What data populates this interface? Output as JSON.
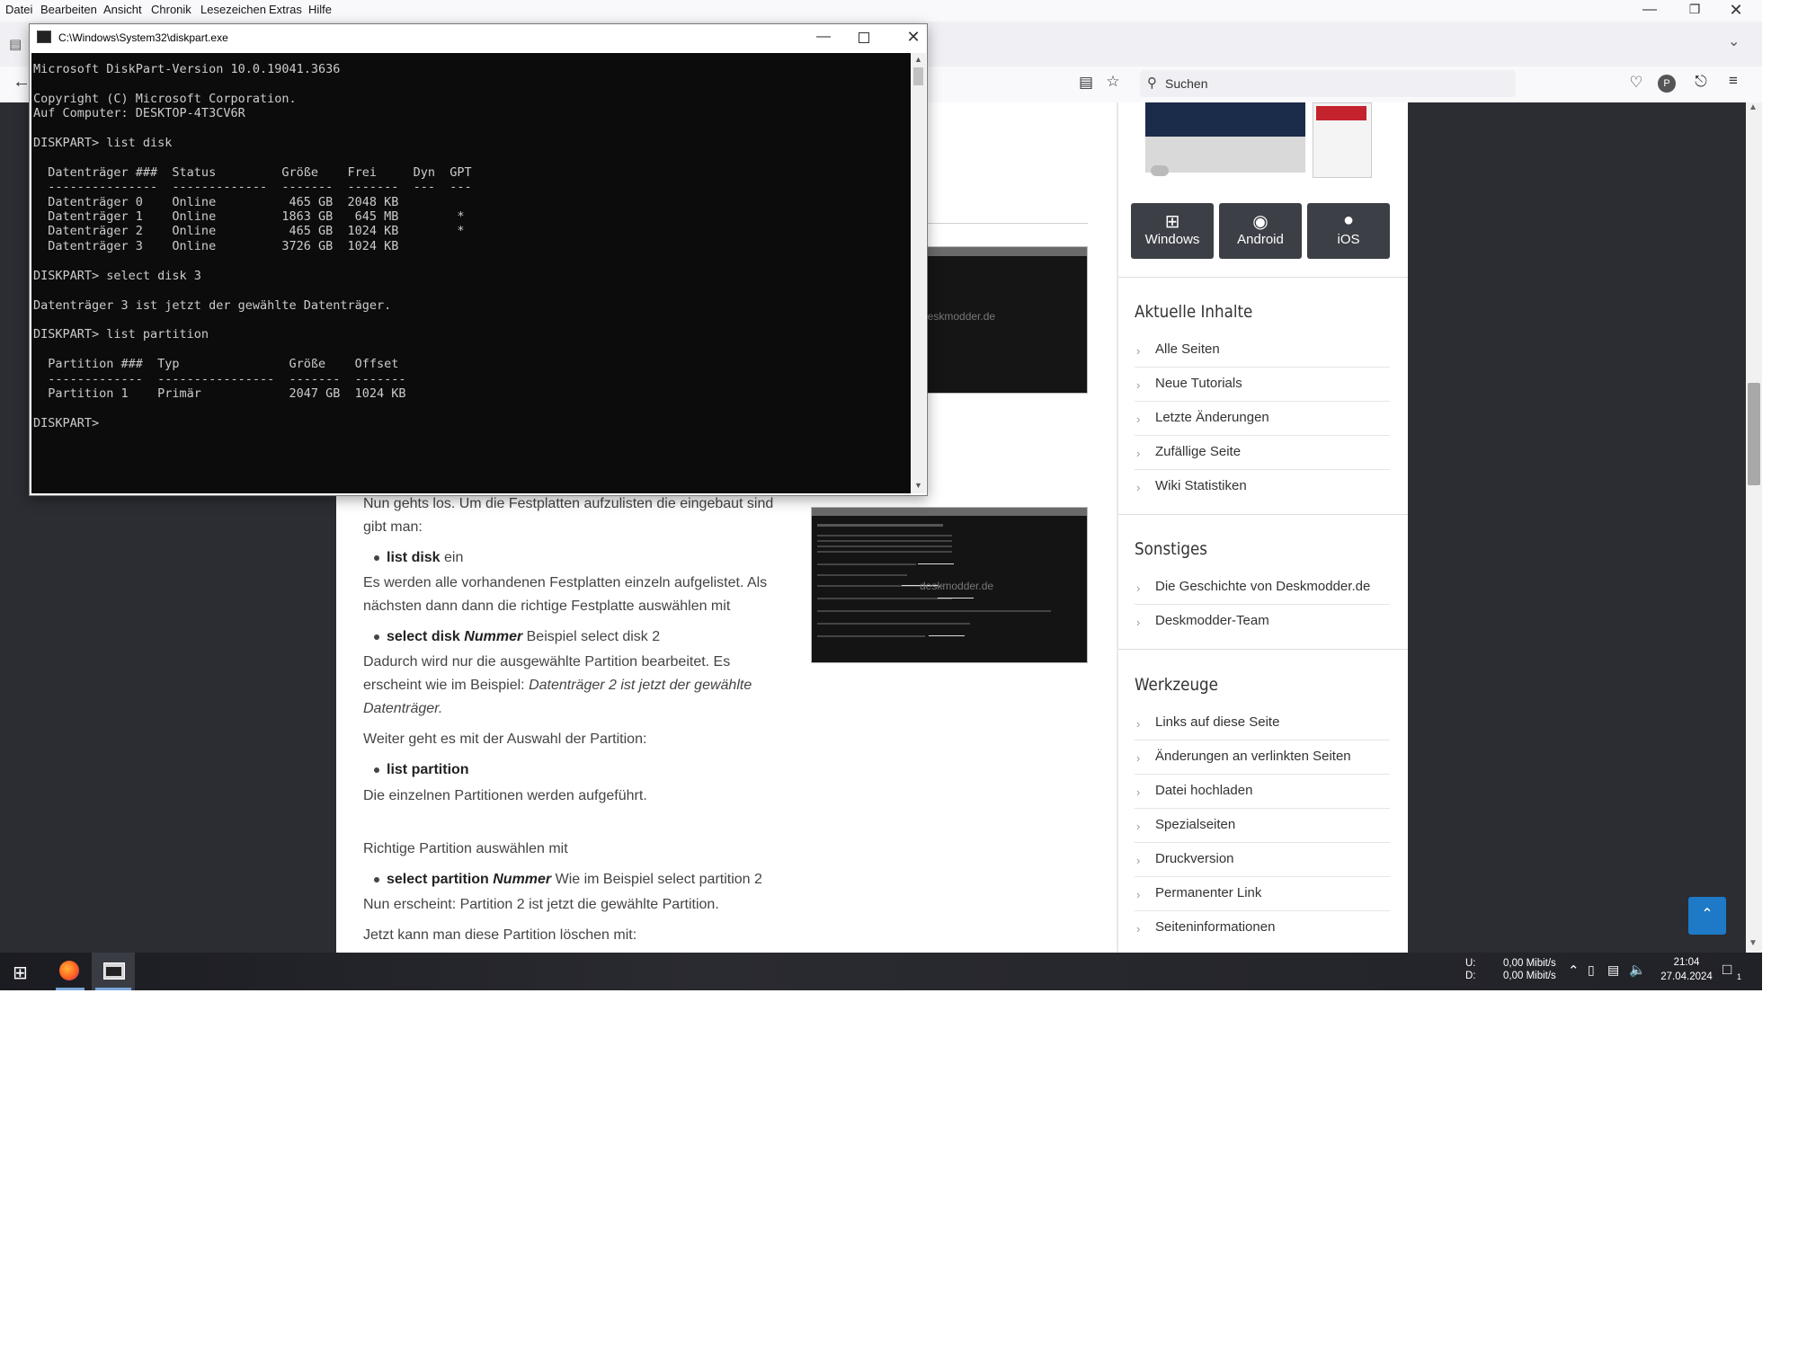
{
  "menubar": {
    "items": [
      "Datei",
      "Bearbeiten",
      "Ansicht",
      "Chronik",
      "Lesezeichen",
      "Extras",
      "Hilfe"
    ]
  },
  "browser": {
    "search_placeholder": "Suchen"
  },
  "cmd": {
    "title": "C:\\Windows\\System32\\diskpart.exe",
    "lines": [
      "Microsoft DiskPart-Version 10.0.19041.3636",
      "",
      "Copyright (C) Microsoft Corporation.",
      "Auf Computer: DESKTOP-4T3CV6R",
      "",
      "DISKPART> list disk",
      "",
      "  Datenträger ###  Status         Größe    Frei     Dyn  GPT",
      "  ---------------  -------------  -------  -------  ---  ---",
      "  Datenträger 0    Online          465 GB  2048 KB",
      "  Datenträger 1    Online         1863 GB   645 MB        *",
      "  Datenträger 2    Online          465 GB  1024 KB        *",
      "  Datenträger 3    Online         3726 GB  1024 KB",
      "",
      "DISKPART> select disk 3",
      "",
      "Datenträger 3 ist jetzt der gewählte Datenträger.",
      "",
      "DISKPART> list partition",
      "",
      "  Partition ###  Typ               Größe    Offset",
      "  -------------  ----------------  -------  -------",
      "  Partition 1    Primär            2047 GB  1024 KB",
      "",
      "DISKPART> "
    ]
  },
  "article": {
    "p1": "Nun gehts los. Um die Festplatten aufzulisten die eingebaut sind",
    "p1b": "gibt man:",
    "li1_bold": "list disk",
    "li1_rest": " ein",
    "p2a": "Es werden alle vorhandenen Festplatten einzeln aufgelistet. Als",
    "p2b": "nächsten dann dann die richtige Festplatte auswählen mit",
    "li2_bold": "select disk ",
    "li2_italic": "Nummer",
    "li2_rest": " Beispiel select disk 2",
    "p3a": "Dadurch wird nur die ausgewählte Partition bearbeitet. Es",
    "p3b_plain": "erscheint wie im Beispiel: ",
    "p3b_italic": "Datenträger 2 ist jetzt der gewählte",
    "p3c_italic": "Datenträger.",
    "p4": "Weiter geht es mit der Auswahl der Partition:",
    "li3_bold": "list partition",
    "p5": "Die einzelnen Partitionen werden aufgeführt.",
    "p6": "Richtige Partition auswählen mit",
    "li4_bold": "select partition ",
    "li4_italic": "Nummer",
    "li4_rest": " Wie im Beispiel select partition 2",
    "p7": "Nun erscheint: Partition 2 ist jetzt die gewählte Partition.",
    "p8": "Jetzt kann man diese Partition löschen mit:",
    "thumb_watermark": "deskmodder.de"
  },
  "sidebar": {
    "os_buttons": [
      "Windows",
      "Android",
      "iOS"
    ],
    "aktuelle_title": "Aktuelle Inhalte",
    "aktuelle": [
      "Alle Seiten",
      "Neue Tutorials",
      "Letzte Änderungen",
      "Zufällige Seite",
      "Wiki Statistiken"
    ],
    "sonstiges_title": "Sonstiges",
    "sonstiges": [
      "Die Geschichte von Deskmodder.de",
      "Deskmodder-Team"
    ],
    "werkzeuge_title": "Werkzeuge",
    "werkzeuge": [
      "Links auf diese Seite",
      "Änderungen an verlinkten Seiten",
      "Datei hochladen",
      "Spezialseiten",
      "Druckversion",
      "Permanenter Link",
      "Seiteninformationen"
    ]
  },
  "taskbar": {
    "net_up_label": "U:",
    "net_down_label": "D:",
    "net_up": "0,00 Mibit/s",
    "net_down": "0,00 Mibit/s",
    "time": "21:04",
    "date": "27.04.2024",
    "notif_count": "1"
  }
}
